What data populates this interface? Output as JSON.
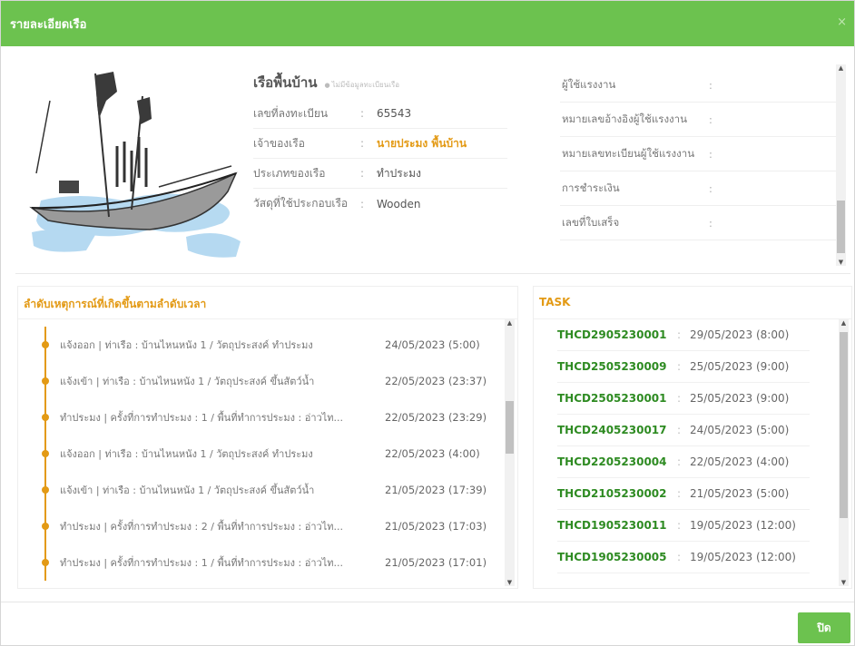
{
  "modal": {
    "title": "รายละเอียดเรือ",
    "close_icon": "×",
    "close_button_label": "ปิด"
  },
  "boat": {
    "name": "เรือพื้นบ้าน",
    "note": "ไม่มีข้อมูลทะเบียนเรือ",
    "fields": [
      {
        "label": "เลขที่ลงทะเบียน",
        "value": "65543"
      },
      {
        "label": "เจ้าของเรือ",
        "value": "นายประมง พื้นบ้าน"
      },
      {
        "label": "ประเภทของเรือ",
        "value": "ทำประมง"
      },
      {
        "label": "วัสดุที่ใช้ประกอบเรือ",
        "value": "Wooden"
      }
    ]
  },
  "worker_info": {
    "rows": [
      {
        "label": "ผู้ใช้แรงงาน",
        "value": ":"
      },
      {
        "label": "หมายเลขอ้างอิงผู้ใช้แรงงาน",
        "value": ":"
      },
      {
        "label": "หมายเลขทะเบียนผู้ใช้แรงงาน",
        "value": ":"
      },
      {
        "label": "การชำระเงิน",
        "value": ":"
      },
      {
        "label": "เลขที่ใบเสร็จ",
        "value": ":"
      }
    ]
  },
  "timeline": {
    "title": "ลำดับเหตุการณ์ที่เกิดขึ้นตามลำดับเวลา",
    "items": [
      {
        "text": "แจ้งออก | ท่าเรือ : บ้านไหนหนัง 1 / วัตถุประสงค์ ทำประมง",
        "date": "24/05/2023 (5:00)"
      },
      {
        "text": "แจ้งเข้า | ท่าเรือ : บ้านไหนหนัง 1 / วัตถุประสงค์ ขึ้นสัตว์น้ำ",
        "date": "22/05/2023 (23:37)"
      },
      {
        "text": "ทำประมง | ครั้งที่การทำประมง : 1 / พื้นที่ทำการประมง : อ่าวไท...",
        "date": "22/05/2023 (23:29)"
      },
      {
        "text": "แจ้งออก | ท่าเรือ : บ้านไหนหนัง 1 / วัตถุประสงค์ ทำประมง",
        "date": "22/05/2023 (4:00)"
      },
      {
        "text": "แจ้งเข้า | ท่าเรือ : บ้านไหนหนัง 1 / วัตถุประสงค์ ขึ้นสัตว์น้ำ",
        "date": "21/05/2023 (17:39)"
      },
      {
        "text": "ทำประมง | ครั้งที่การทำประมง : 2 / พื้นที่ทำการประมง : อ่าวไท...",
        "date": "21/05/2023 (17:03)"
      },
      {
        "text": "ทำประมง | ครั้งที่การทำประมง : 1 / พื้นที่ทำการประมง : อ่าวไท...",
        "date": "21/05/2023 (17:01)"
      }
    ]
  },
  "tasks": {
    "title": "TASK",
    "items": [
      {
        "code": "THCD2905230001",
        "date": "29/05/2023 (8:00)"
      },
      {
        "code": "THCD2505230009",
        "date": "25/05/2023 (9:00)"
      },
      {
        "code": "THCD2505230001",
        "date": "25/05/2023 (9:00)"
      },
      {
        "code": "THCD2405230017",
        "date": "24/05/2023 (5:00)"
      },
      {
        "code": "THCD2205230004",
        "date": "22/05/2023 (4:00)"
      },
      {
        "code": "THCD2105230002",
        "date": "21/05/2023 (5:00)"
      },
      {
        "code": "THCD1905230011",
        "date": "19/05/2023 (12:00)"
      },
      {
        "code": "THCD1905230005",
        "date": "19/05/2023 (12:00)"
      }
    ]
  },
  "colors": {
    "header_green": "#6cc24f",
    "accent_orange": "#e39a15",
    "task_green": "#2e8b22"
  }
}
